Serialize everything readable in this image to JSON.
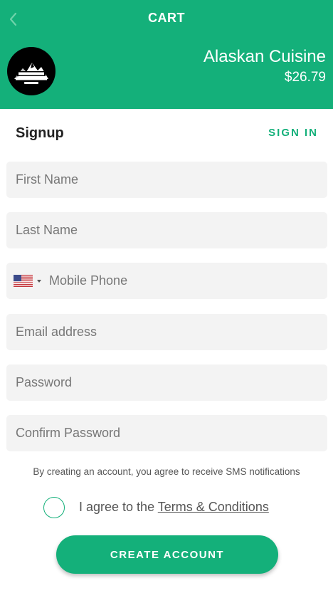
{
  "theme": {
    "accent": "#14b07a",
    "field_bg": "#f3f3f3"
  },
  "header": {
    "title": "CART",
    "back_icon": "chevron-left-icon",
    "logo_icon": "mountain-logo-icon",
    "restaurant_name": "Alaskan Cuisine",
    "cart_total": "$26.79"
  },
  "signup": {
    "title": "Signup",
    "sign_in_label": "SIGN IN",
    "fields": {
      "first_name": {
        "placeholder": "First Name",
        "value": ""
      },
      "last_name": {
        "placeholder": "Last Name",
        "value": ""
      },
      "mobile_phone": {
        "placeholder": "Mobile Phone",
        "value": "",
        "country_flag_icon": "us-flag-icon"
      },
      "email": {
        "placeholder": "Email address",
        "value": ""
      },
      "password": {
        "placeholder": "Password",
        "value": ""
      },
      "confirm_password": {
        "placeholder": "Confirm Password",
        "value": ""
      }
    },
    "sms_notice": "By creating an account, you agree to receive SMS notifications",
    "terms_prefix": "I agree to the",
    "terms_link": "Terms & Conditions",
    "terms_checked": false,
    "create_button_label": "CREATE ACCOUNT"
  }
}
